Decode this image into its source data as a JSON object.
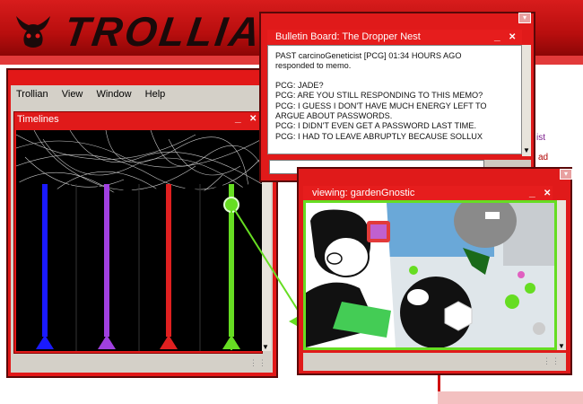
{
  "app": {
    "title": "TROLLIAN"
  },
  "main_window": {
    "menu": [
      "Trollian",
      "View",
      "Window",
      "Help"
    ],
    "timelines_title": "Timelines",
    "timeline_colors": [
      "#1a1aff",
      "#a040e0",
      "#e02020",
      "#66dd22"
    ]
  },
  "bulletin_board": {
    "title": "Bulletin Board: The Dropper Nest",
    "header_line1": "PAST carcinoGeneticist [PCG] 01:34 HOURS AGO",
    "header_line2": "responded to memo.",
    "messages": [
      "PCG: JADE?",
      "PCG: ARE YOU STILL RESPONDING TO THIS MEMO?",
      "PCG: I GUESS I DON'T HAVE MUCH ENERGY LEFT TO",
      "ARGUE ABOUT PASSWORDS.",
      "PCG: I DIDN'T EVEN GET A PASSWORD LAST TIME.",
      "PCG: I HAD TO LEAVE ABRUPTLY BECAUSE SOLLUX"
    ],
    "input_value": ""
  },
  "viewing_window": {
    "title": "viewing: gardenGnostic"
  },
  "background_window": {
    "line1": "ist",
    "line2": "ad"
  },
  "controls": {
    "minimize": "_",
    "close": "✕",
    "scroll_down": "▼",
    "menu_arrow": "▾"
  },
  "colors": {
    "accent_red": "#e01a1a",
    "dark_red": "#5a0808",
    "highlight_green": "#66dd22",
    "pcg_gray": "#555555"
  }
}
